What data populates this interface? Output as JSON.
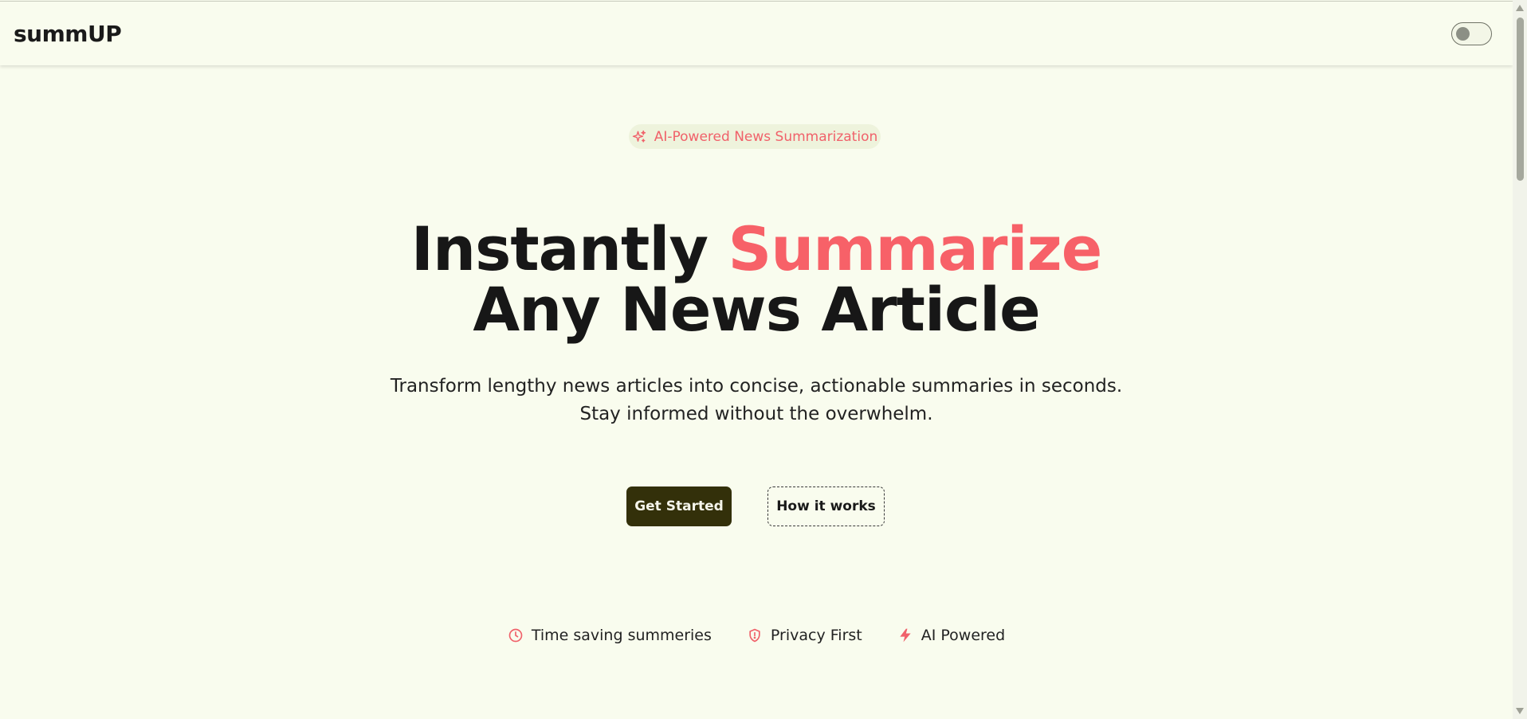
{
  "navbar": {
    "brand": "summUP",
    "theme_toggle": {
      "state": "off"
    }
  },
  "badge": {
    "icon": "sparkles-icon",
    "text": "AI-Powered News Summarization"
  },
  "hero": {
    "title_part1": "Instantly ",
    "title_highlight": "Summarize",
    "title_line2": "Any News Article"
  },
  "subtitle": {
    "line1": "Transform lengthy news articles into concise, actionable summaries in seconds.",
    "line2": "Stay informed without the overwhelm."
  },
  "actions": {
    "primary_label": "Get Started",
    "secondary_label": "How it works"
  },
  "features": [
    {
      "icon": "clock-icon",
      "label": "Time saving summeries"
    },
    {
      "icon": "shield-icon",
      "label": "Privacy First"
    },
    {
      "icon": "lightning-icon",
      "label": "AI Powered"
    }
  ],
  "colors": {
    "background": "#f9fcee",
    "accent": "#f76168",
    "primary_button": "#33300a"
  }
}
